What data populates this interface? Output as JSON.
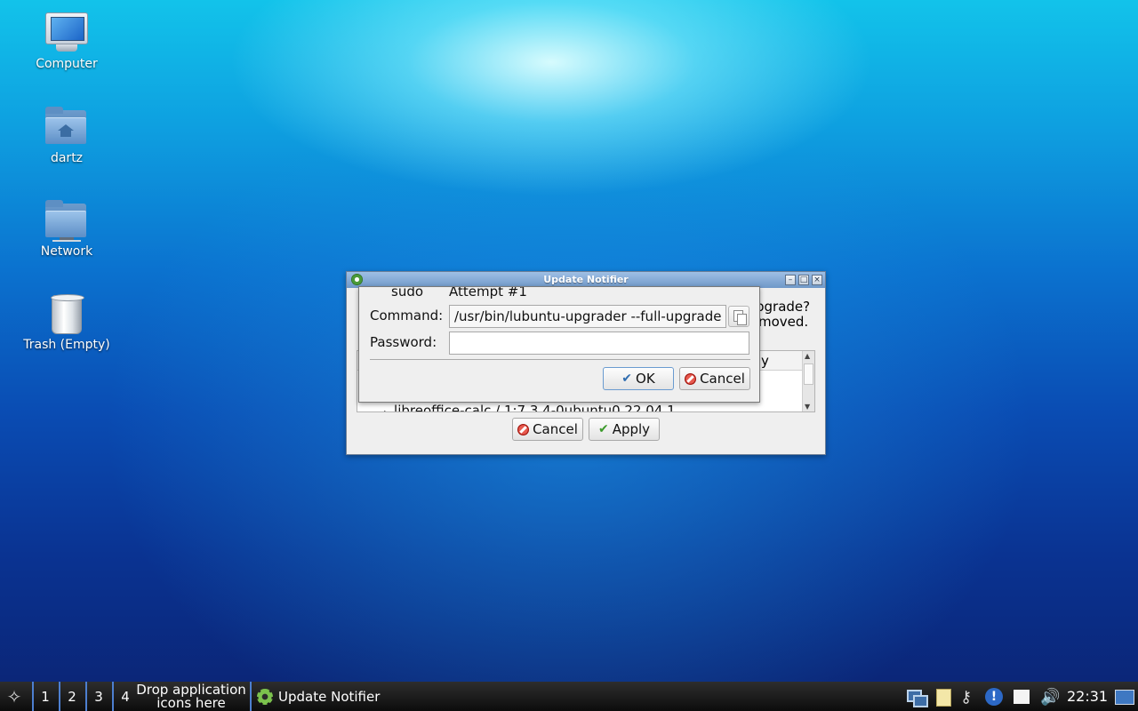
{
  "desktop": {
    "icons": [
      {
        "label": "Computer",
        "icon": "computer-icon"
      },
      {
        "label": "dartz",
        "icon": "home-folder-icon"
      },
      {
        "label": "Network",
        "icon": "network-folder-icon"
      },
      {
        "label": "Trash (Empty)",
        "icon": "trash-icon"
      }
    ]
  },
  "update_window": {
    "title": "Update Notifier",
    "question_partial_1": "pgrade?",
    "question_partial_2": "moved.",
    "list_header_partial": "y",
    "list_row_partial": "libreoffice-calc  /  1:7.3.4-0ubuntu0.22.04.1",
    "cancel_label": "Cancel",
    "apply_label": "Apply"
  },
  "sudo_dialog": {
    "top_left_partial": "sudo",
    "top_right_partial": "Attempt #1",
    "command_label": "Command:",
    "command_value": "/usr/bin/lubuntu-upgrader --full-upgrade",
    "password_label": "Password:",
    "password_value": "",
    "ok_label": "OK",
    "cancel_label": "Cancel"
  },
  "taskbar": {
    "desktops": [
      "1",
      "2",
      "3",
      "4"
    ],
    "drop_line1": "Drop application",
    "drop_line2": "icons here",
    "task_label": "Update Notifier",
    "clock": "22:31"
  },
  "colors": {
    "titlebar": "#6f98c8",
    "taskbar": "#0c0c0c",
    "accent": "#4d7fd0"
  }
}
